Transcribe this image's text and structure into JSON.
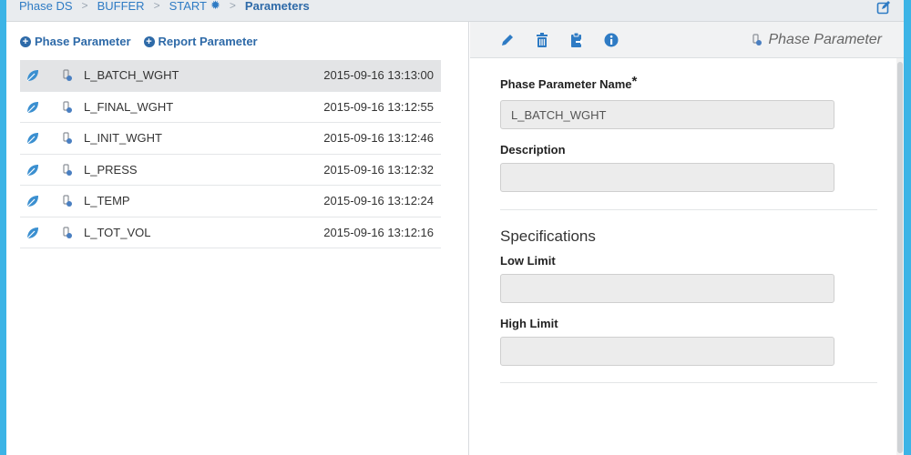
{
  "breadcrumb": {
    "items": [
      "Phase DS",
      "BUFFER",
      "START",
      "Parameters"
    ],
    "separator": ">"
  },
  "left": {
    "add_phase": "Phase Parameter",
    "add_report": "Report Parameter",
    "rows": [
      {
        "name": "L_BATCH_WGHT",
        "time": "2015-09-16 13:13:00",
        "selected": true
      },
      {
        "name": "L_FINAL_WGHT",
        "time": "2015-09-16 13:12:55",
        "selected": false
      },
      {
        "name": "L_INIT_WGHT",
        "time": "2015-09-16 13:12:46",
        "selected": false
      },
      {
        "name": "L_PRESS",
        "time": "2015-09-16 13:12:32",
        "selected": false
      },
      {
        "name": "L_TEMP",
        "time": "2015-09-16 13:12:24",
        "selected": false
      },
      {
        "name": "L_TOT_VOL",
        "time": "2015-09-16 13:12:16",
        "selected": false
      }
    ]
  },
  "right": {
    "panel_title": "Phase Parameter",
    "toolbar_icons": [
      "pencil-icon",
      "trash-icon",
      "clipboard-icon",
      "info-icon"
    ],
    "name_label": "Phase Parameter Name",
    "required_mark": "*",
    "name_value": "L_BATCH_WGHT",
    "description_label": "Description",
    "description_value": "",
    "specs_heading": "Specifications",
    "low_label": "Low Limit",
    "low_value": "",
    "high_label": "High Limit",
    "high_value": ""
  },
  "colors": {
    "accent": "#2e6aa8",
    "frame": "#3cb4e6",
    "leaf": "#3a8fd0",
    "selected_row": "#e3e4e6"
  }
}
